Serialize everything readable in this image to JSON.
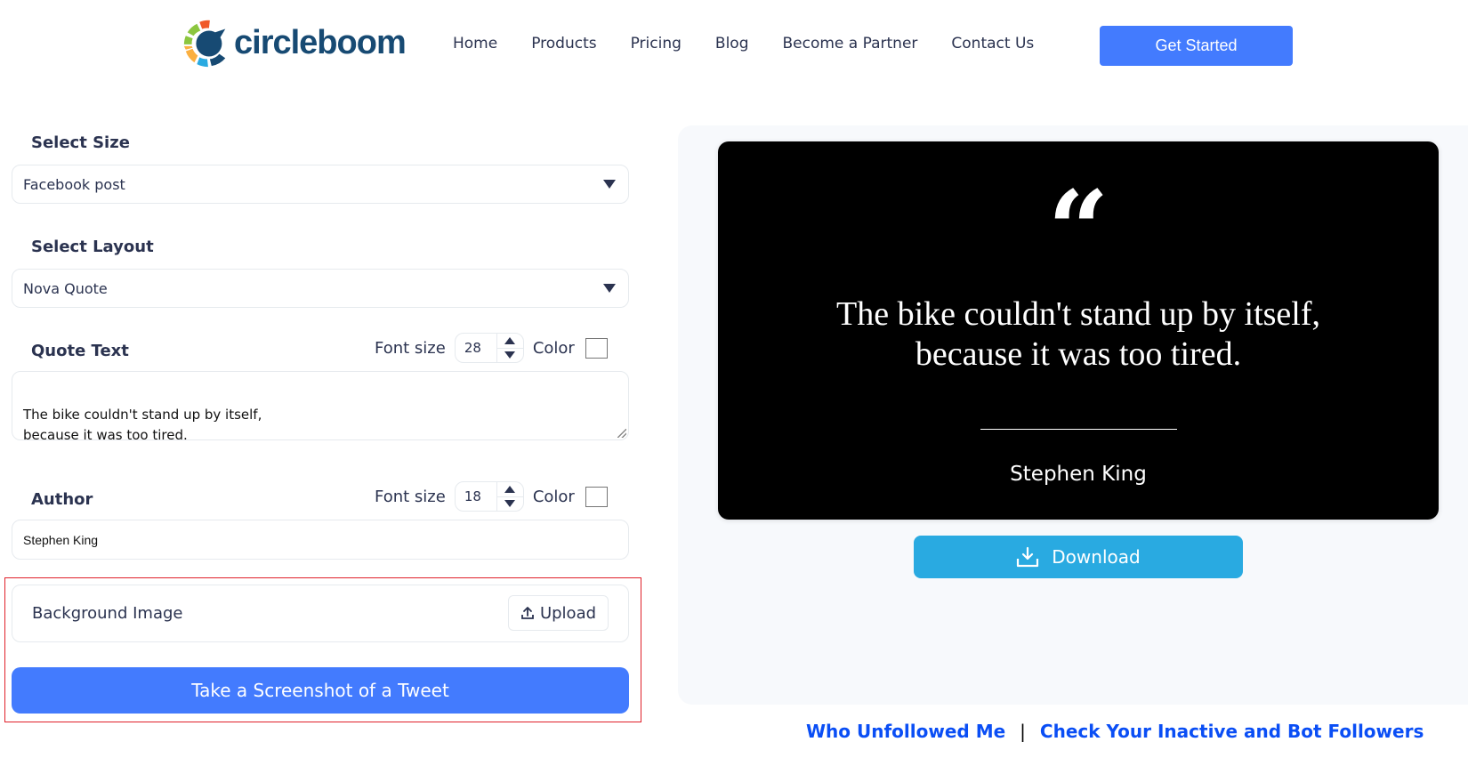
{
  "header": {
    "logo_text": "circleboom",
    "nav": [
      "Home",
      "Products",
      "Pricing",
      "Blog",
      "Become a Partner",
      "Contact Us"
    ],
    "cta_label": "Get Started",
    "colors": {
      "primary": "#437bfe",
      "logo": "#174a73"
    }
  },
  "form": {
    "size": {
      "label": "Select Size",
      "value": "Facebook post"
    },
    "layout": {
      "label": "Select Layout",
      "value": "Nova Quote"
    },
    "quote": {
      "label": "Quote Text",
      "font_size_label": "Font size",
      "font_size": "28",
      "color_label": "Color",
      "color_value": "#ffffff",
      "text": "The bike couldn't stand up by itself,\nbecause it was too tired."
    },
    "author": {
      "label": "Author",
      "font_size_label": "Font size",
      "font_size": "18",
      "color_label": "Color",
      "color_value": "#ffffff",
      "value": "Stephen King"
    },
    "background": {
      "label": "Background Image",
      "upload_label": "Upload"
    },
    "screenshot_button": "Take a Screenshot of a Tweet"
  },
  "preview": {
    "quote_mark": "“",
    "quote_text": "The bike couldn't stand up by itself,\nbecause it was too tired.",
    "author": "Stephen King",
    "background": "#000000",
    "download_label": "Download",
    "download_color": "#29aae1"
  },
  "footer_links": {
    "link1": "Who Unfollowed Me",
    "separator": "|",
    "link2": "Check Your Inactive and Bot Followers"
  }
}
